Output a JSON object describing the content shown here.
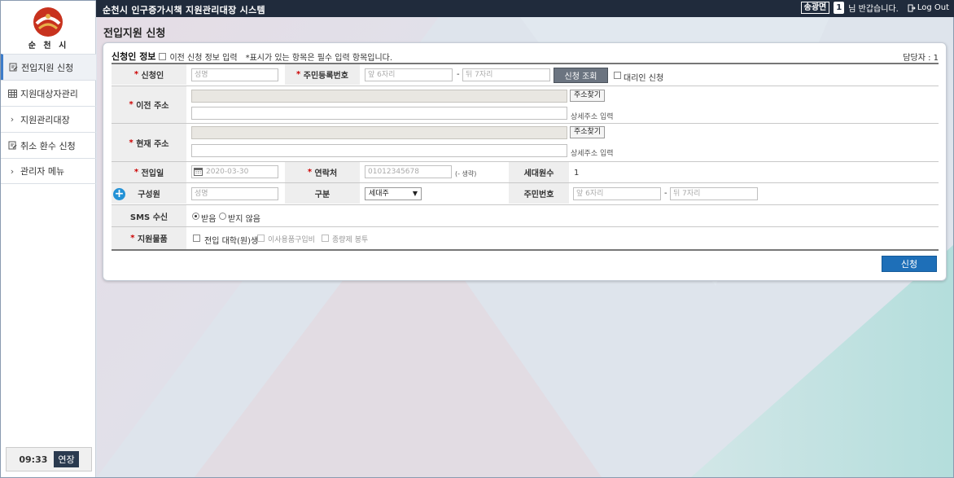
{
  "header": {
    "title": "순천시 인구증가시책 지원관리대장 시스템",
    "user_name": "송광면",
    "count": "1",
    "greeting": "님 반갑습니다.",
    "logout": "Log Out"
  },
  "sidebar": {
    "logo_text": "순 천 시",
    "items": [
      {
        "label": "전입지원 신청",
        "icon": "document-edit-icon"
      },
      {
        "label": "지원대상자관리",
        "icon": "table-icon"
      },
      {
        "label": "지원관리대장",
        "icon": "chevron-right-icon"
      },
      {
        "label": "취소 환수 신청",
        "icon": "document-edit-icon"
      },
      {
        "label": "관리자 메뉴",
        "icon": "chevron-right-icon"
      }
    ],
    "timer": "09:33",
    "extend_label": "연장"
  },
  "page": {
    "title": "전입지원 신청"
  },
  "form": {
    "section_title": "신청인 정보",
    "prev_info_label": "이전 신청 정보 입력",
    "required_note": "*표시가 있는 항목은 필수 입력 항목입니다.",
    "manager": "담당자 : 1",
    "labels": {
      "applicant": "신청인",
      "resident_no": "주민등록번호",
      "prev_address": "이전 주소",
      "current_address": "현재 주소",
      "move_date": "전입일",
      "contact": "연락처",
      "household_count": "세대원수",
      "member": "구성원",
      "relation": "구분",
      "member_resident_no": "주민번호",
      "sms": "SMS 수신",
      "support_item": "지원물품"
    },
    "placeholders": {
      "name": "성명",
      "front6": "앞 6자리",
      "back7": "뒤 7자리",
      "move_date": "2020-03-30",
      "contact": "01012345678"
    },
    "lookup_button": "신청 조회",
    "proxy_label": "대리인 신청",
    "find_address": "주소찾기",
    "detail_address": "상세주소 입력",
    "contact_hint": "(- 생략)",
    "household_count_value": "1",
    "relation_value": "세대주",
    "sms_options": [
      "받음",
      "받지 않음"
    ],
    "support_items": [
      "전입 대학(원)생",
      "이사용품구입비",
      "종량제 봉투"
    ],
    "submit": "신청"
  },
  "colors": {
    "topbar": "#202b3c",
    "accent": "#1e6fb8",
    "required": "#cc0000"
  }
}
